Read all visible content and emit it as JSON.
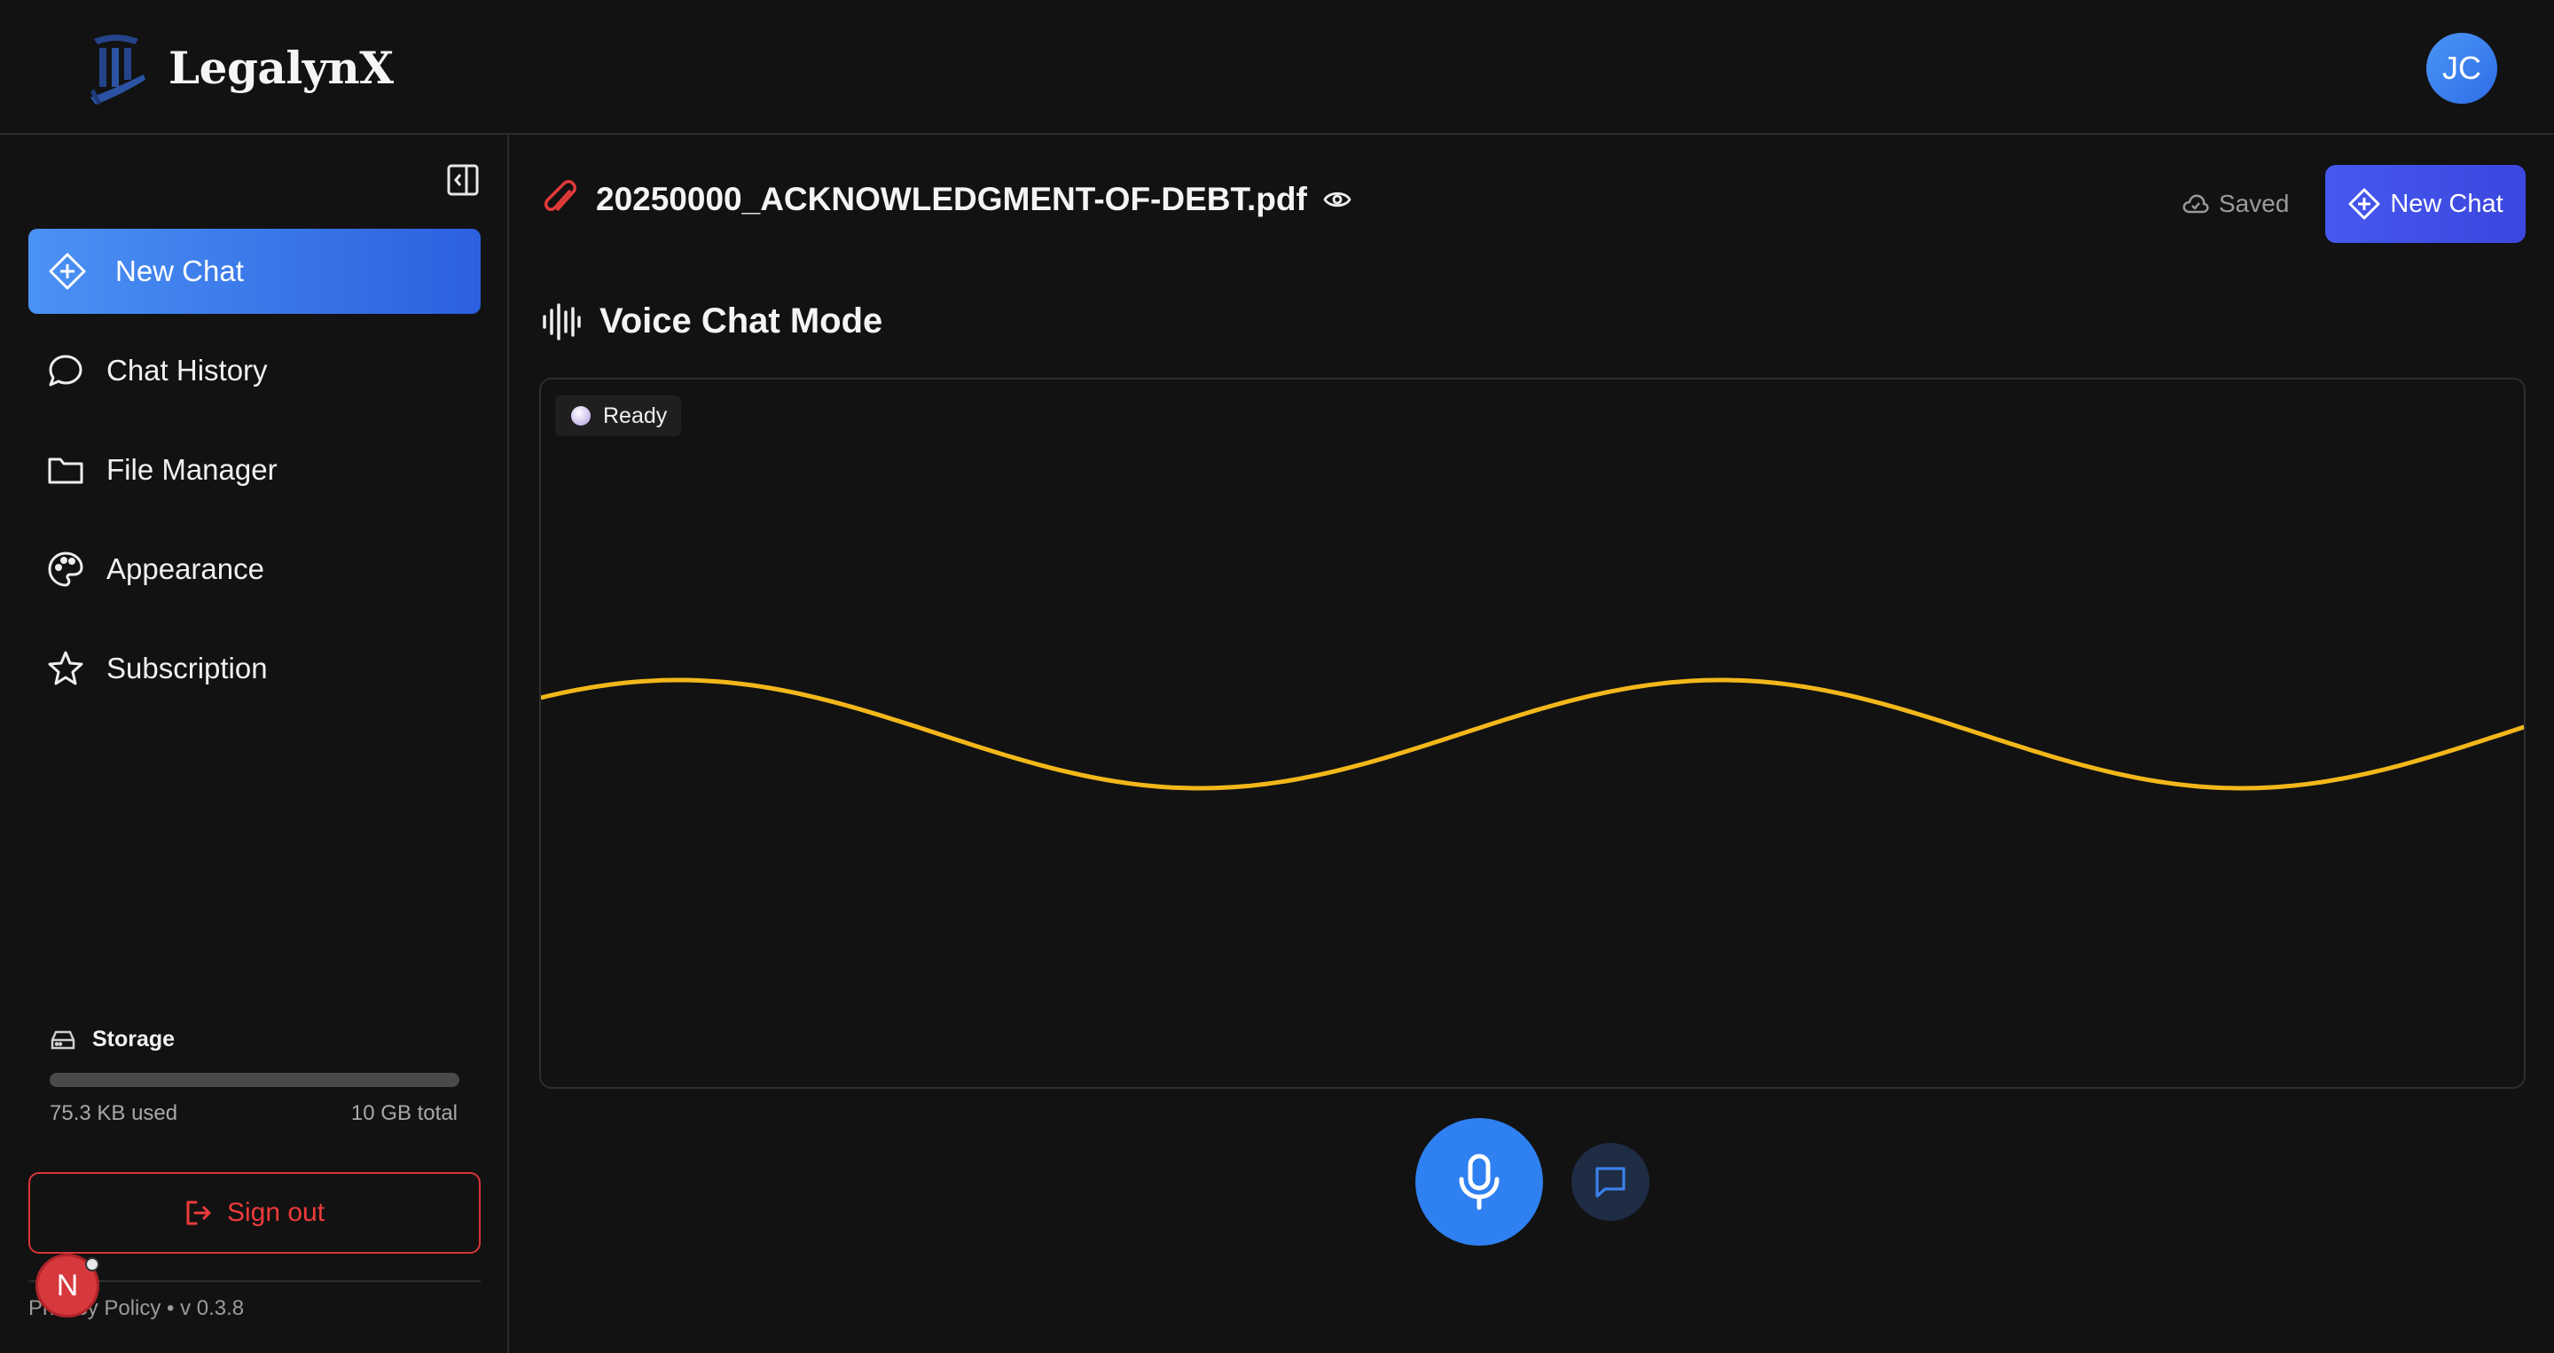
{
  "header": {
    "app_name": "LegalynX",
    "avatar_initials": "JC"
  },
  "sidebar": {
    "items": [
      {
        "label": "New Chat",
        "icon": "plus-diamond-icon",
        "active": true
      },
      {
        "label": "Chat History",
        "icon": "chat-bubble-icon"
      },
      {
        "label": "File Manager",
        "icon": "folder-icon"
      },
      {
        "label": "Appearance",
        "icon": "palette-icon"
      },
      {
        "label": "Subscription",
        "icon": "star-icon"
      }
    ],
    "storage": {
      "label": "Storage",
      "used": "75.3 KB used",
      "total": "10 GB total",
      "fraction": 1e-05
    },
    "signout_label": "Sign out",
    "footer": "Privacy Policy • v 0.3.8",
    "notification_badge": "N"
  },
  "main": {
    "document_title": "20250000_ACKNOWLEDGMENT-OF-DEBT.pdf",
    "saved_label": "Saved",
    "new_chat_label": "New Chat",
    "voice_heading": "Voice Chat Mode",
    "status": "Ready"
  },
  "colors": {
    "accent_blue": "#2f80f0",
    "accent_indigo": "#4658ee",
    "danger": "#ee3b3b",
    "wave": "#f2b71a"
  }
}
